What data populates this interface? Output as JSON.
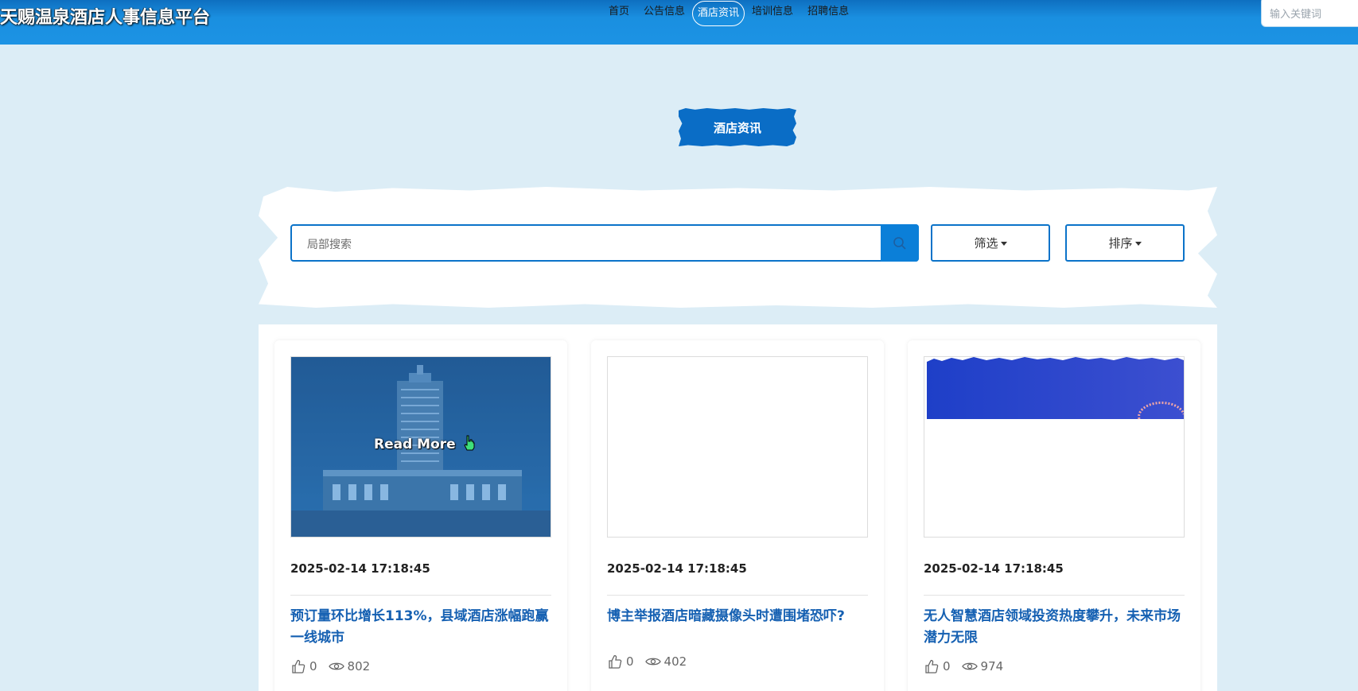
{
  "header": {
    "brand": "天赐温泉酒店人事信息平台",
    "nav": [
      "首页",
      "公告信息",
      "酒店资讯",
      "培训信息",
      "招聘信息"
    ],
    "active_nav": "酒店资讯",
    "search_placeholder": "输入关键词"
  },
  "section": {
    "title": "酒店资讯"
  },
  "filters": {
    "search_placeholder": "局部搜索",
    "filter_label": "筛选",
    "sort_label": "排序"
  },
  "cards": [
    {
      "date": "2025-02-14 17:18:45",
      "title": "预订量环比增长113%，县域酒店涨幅跑赢一线城市",
      "likes": "0",
      "views": "802",
      "overlay": "Read More",
      "image": "hotel-building-photo"
    },
    {
      "date": "2025-02-14 17:18:45",
      "title": "博主举报酒店暗藏摄像头时遭围堵恐吓?",
      "likes": "0",
      "views": "402",
      "image": "blank"
    },
    {
      "date": "2025-02-14 17:18:45",
      "title": "无人智慧酒店领域投资热度攀升，未来市场潜力无限",
      "likes": "0",
      "views": "974",
      "image": "blue-banner-partial"
    }
  ],
  "colors": {
    "accent": "#0b73c9",
    "title_link": "#1560b2",
    "header": "#1a8fe0",
    "page_bg": "#dcedf6"
  }
}
